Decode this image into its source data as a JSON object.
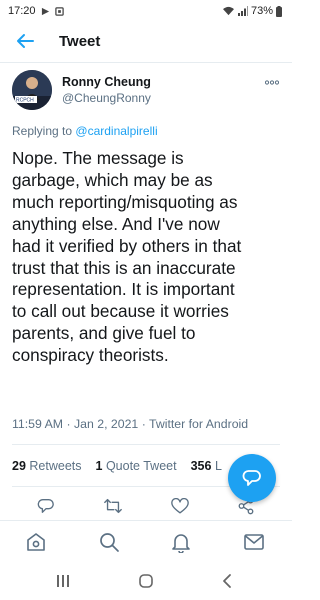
{
  "status_bar": {
    "time": "17:20",
    "battery": "73%",
    "icons": [
      "play-icon",
      "gallery-icon",
      "wifi-icon",
      "signal-icon",
      "battery-icon"
    ]
  },
  "header": {
    "title": "Tweet",
    "back_icon": "arrow-left-icon"
  },
  "author": {
    "name": "Ronny Cheung",
    "handle": "@CheungRonny",
    "avatar_text": "RCPCH"
  },
  "reply": {
    "prefix": "Replying to",
    "mention": "@cardinalpirelli"
  },
  "tweet": {
    "lines": [
      "Nope. The message is",
      "garbage, which may be as",
      "much reporting/misquoting as",
      "anything else. And I've now",
      "had it verified by others in that",
      "trust that this is an inaccurate",
      "representation. It is important",
      "to call out because it worries",
      "parents, and give fuel to",
      "conspiracy theorists."
    ],
    "time": "11:59 AM",
    "date": "Jan 2, 2021",
    "source": "Twitter for Android",
    "separator": "·"
  },
  "stats": {
    "retweets_count": "29",
    "retweets_label": "Retweets",
    "quote_count": "1",
    "quote_label": "Quote Tweet",
    "likes_count": "356",
    "likes_label": "L"
  },
  "actions": [
    "reply-icon",
    "retweet-icon",
    "like-icon",
    "share-icon"
  ],
  "bottom_nav": [
    "home-icon",
    "search-icon",
    "notifications-icon",
    "messages-icon"
  ],
  "system_nav": [
    "recents-icon",
    "home-button-icon",
    "back-icon"
  ],
  "colors": {
    "accent": "#1da1f2",
    "text": "#14171a",
    "secondary": "#5b7083",
    "divider": "#e6ecf0"
  }
}
